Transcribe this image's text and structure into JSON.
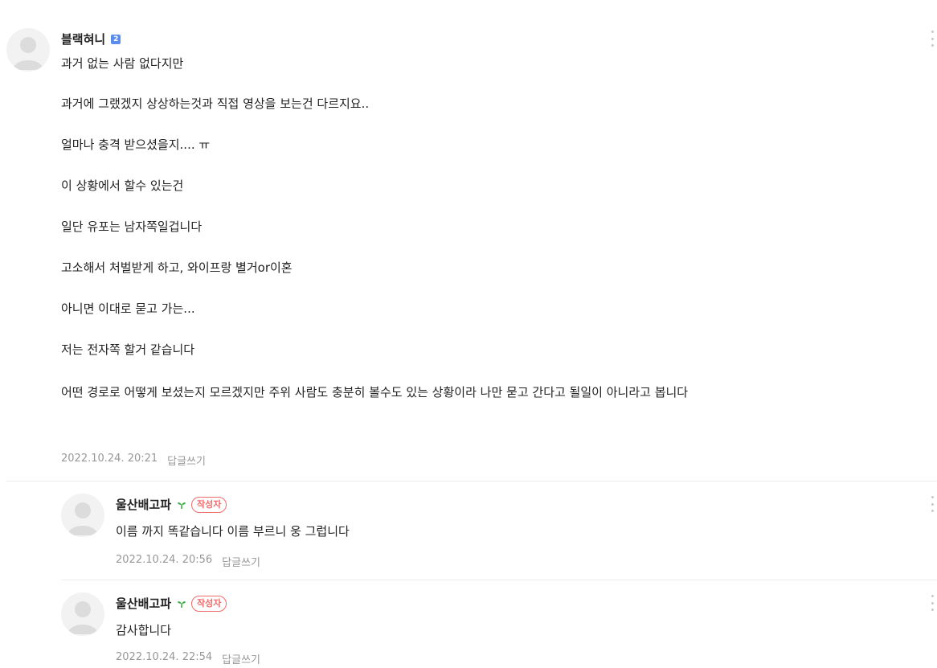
{
  "comments": [
    {
      "author": "블랙혀니",
      "level_badge": "2",
      "lines": [
        "과거 없는 사람 없다지만",
        "과거에 그랬겠지 상상하는것과 직접 영상을 보는건 다르지요..",
        "얼마나 충격 받으셨을지.... ㅠ",
        "이 상황에서 할수 있는건",
        "일단 유포는 남자쪽일겁니다",
        "고소해서 처벌받게 하고, 와이프랑 별거or이혼",
        "아니면 이대로 묻고 가는...",
        "저는 전자쪽 할거 같습니다",
        "어떤 경로로 어떻게 보셨는지 모르겠지만 주위 사람도 충분히 볼수도 있는 상황이라 나만 묻고 간다고 될일이 아니라고 봅니다"
      ],
      "date": "2022.10.24. 20:21",
      "reply_label": "답글쓰기"
    },
    {
      "author": "울산배고파",
      "writer_badge": "작성자",
      "text": "이름 까지 똑같습니다 이름 부르니 웅 그럽니다",
      "date": "2022.10.24. 20:56",
      "reply_label": "답글쓰기"
    },
    {
      "author": "울산배고파",
      "writer_badge": "작성자",
      "text": "감사합니다",
      "date": "2022.10.24. 22:54",
      "reply_label": "답글쓰기"
    }
  ],
  "colors": {
    "writer_badge": "#f06b6b",
    "level_badge": "#5b8def",
    "sprout": "#3cb043",
    "meta_text": "#979797"
  }
}
